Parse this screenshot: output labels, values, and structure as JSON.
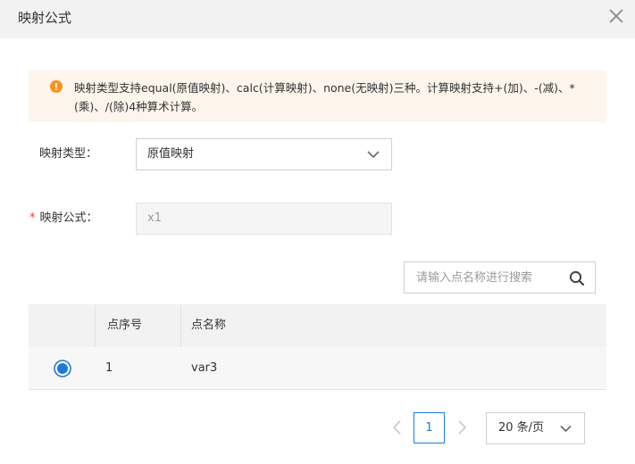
{
  "dialog": {
    "title": "映射公式"
  },
  "alert": {
    "text": "映射类型支持equal(原值映射)、calc(计算映射)、none(无映射)三种。计算映射支持+(加)、-(减)、*(乘)、/(除)4种算术计算。",
    "icon": "warning-icon",
    "color": "#f7931e"
  },
  "form": {
    "mapping_type": {
      "label": "映射类型：",
      "value": "原值映射"
    },
    "mapping_formula": {
      "required_mark": "*",
      "label": "映射公式：",
      "value": "x1"
    }
  },
  "search": {
    "placeholder": "请输入点名称进行搜索"
  },
  "table": {
    "columns": [
      "",
      "点序号",
      "点名称"
    ],
    "rows": [
      {
        "selected": true,
        "index": "1",
        "name": "var3"
      }
    ]
  },
  "pagination": {
    "current_page": "1",
    "page_size": "20 条/页"
  },
  "colors": {
    "accent": "#1a7bdc",
    "warning": "#f7931e",
    "required": "#e4393c"
  }
}
